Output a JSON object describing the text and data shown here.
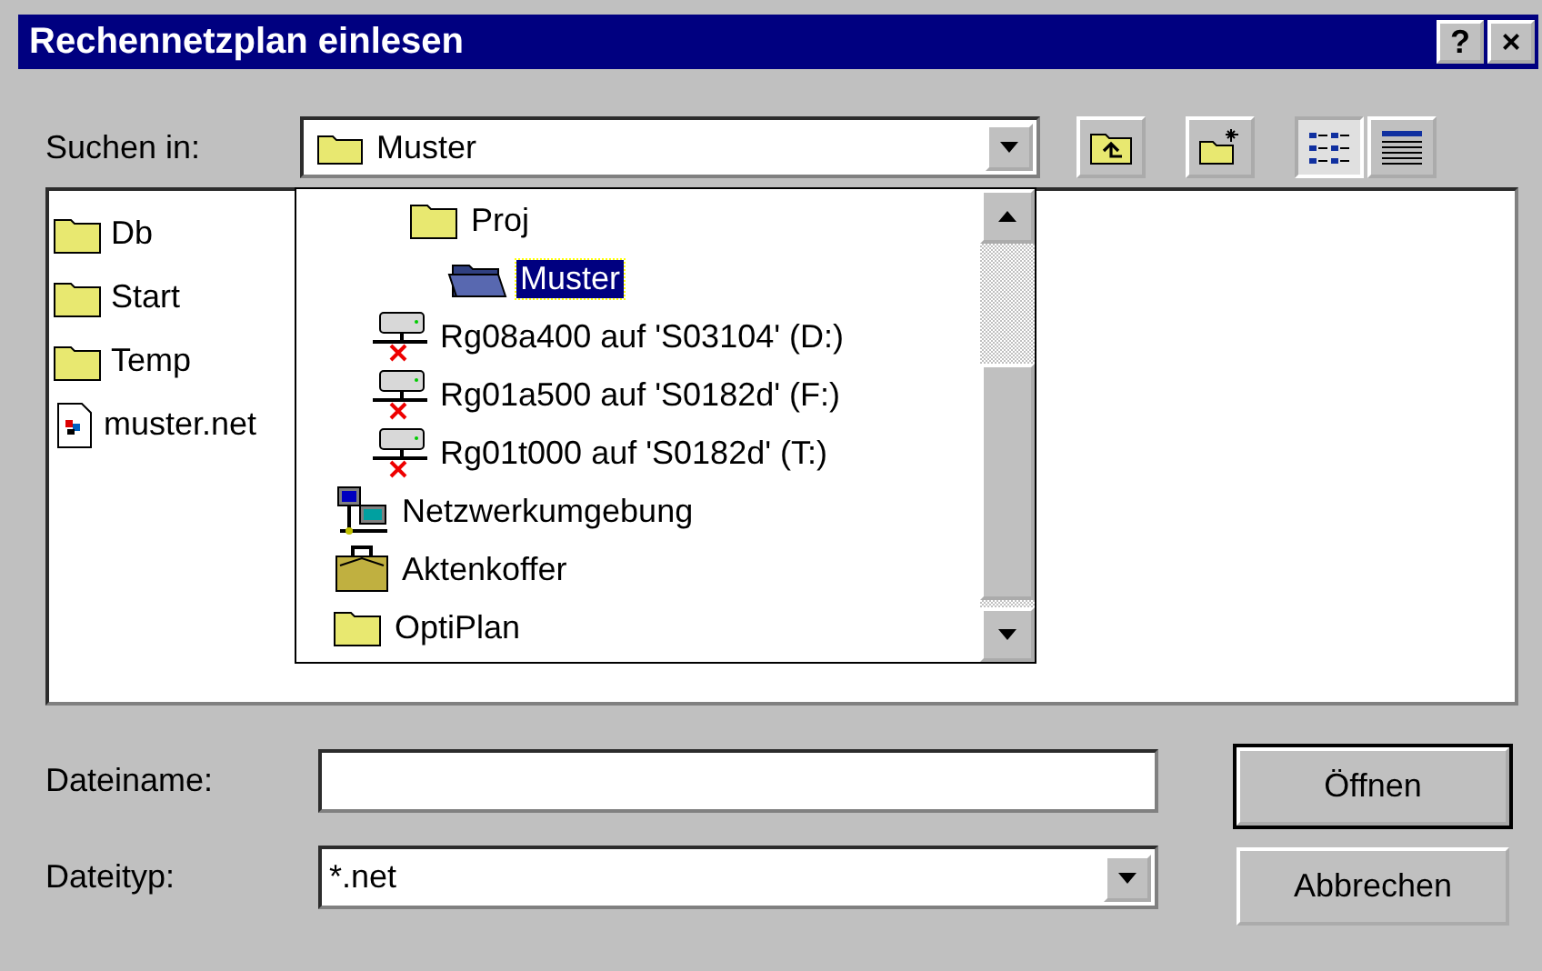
{
  "window": {
    "title": "Rechennetzplan einlesen",
    "buttons": [
      "?",
      "×"
    ]
  },
  "look_in": {
    "label": "Suchen in:",
    "value": "Muster"
  },
  "toolbar": [
    {
      "kind": "up"
    },
    {
      "kind": "new-folder"
    },
    {
      "kind": "list",
      "selected": true
    },
    {
      "kind": "details",
      "selected": false
    }
  ],
  "files": [
    {
      "kind": "folder",
      "label": "Db"
    },
    {
      "kind": "folder",
      "label": "Start"
    },
    {
      "kind": "folder",
      "label": "Temp"
    },
    {
      "kind": "file",
      "label": "muster.net"
    }
  ],
  "dropdown": {
    "items": [
      {
        "kind": "hidden",
        "children": [
          {
            "kind": "hidden",
            "children": [
              {
                "kind": "folder",
                "label": "Proj",
                "selected": false,
                "children": [
                  {
                    "kind": "folder-open",
                    "label": "Muster",
                    "selected": true
                  }
                ]
              }
            ]
          },
          {
            "kind": "drive",
            "label": "Rg08a400 auf 'S03104' (D:)",
            "selected": false
          },
          {
            "kind": "drive",
            "label": "Rg01a500 auf 'S0182d' (F:)",
            "selected": false
          },
          {
            "kind": "drive",
            "label": "Rg01t000 auf 'S0182d' (T:)",
            "selected": false
          }
        ]
      },
      {
        "kind": "network",
        "label": "Netzwerkumgebung",
        "selected": false
      },
      {
        "kind": "briefcase",
        "label": "Aktenkoffer",
        "selected": false
      },
      {
        "kind": "folder",
        "label": "OptiPlan",
        "selected": false
      }
    ]
  },
  "filename": {
    "label": "Dateiname:"
  },
  "filetype": {
    "label": "Dateityp:",
    "value": "*.net"
  },
  "buttons": [
    {
      "label": "Öffnen",
      "default": true
    },
    {
      "label": "Abbrechen",
      "default": false
    }
  ]
}
